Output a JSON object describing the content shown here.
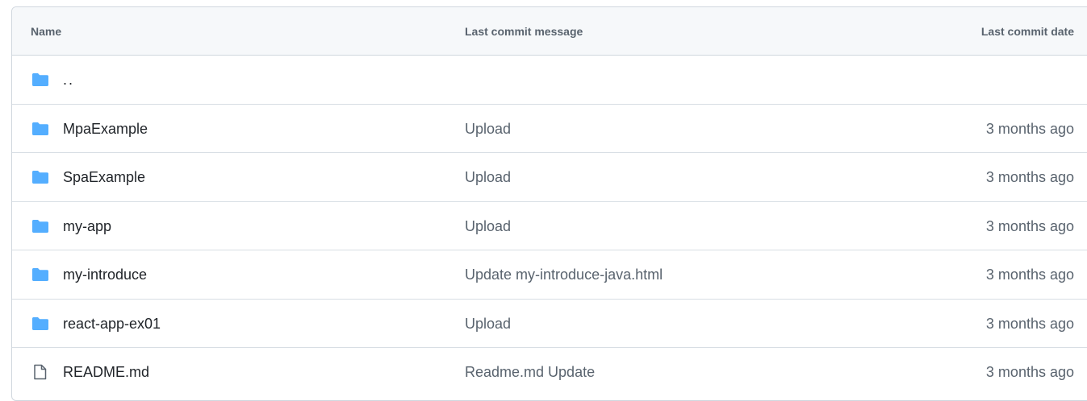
{
  "header": {
    "name": "Name",
    "message": "Last commit message",
    "date": "Last commit date"
  },
  "parent_link": "..",
  "rows": [
    {
      "type": "folder",
      "name": "MpaExample",
      "message": "Upload",
      "date": "3 months ago"
    },
    {
      "type": "folder",
      "name": "SpaExample",
      "message": "Upload",
      "date": "3 months ago"
    },
    {
      "type": "folder",
      "name": "my-app",
      "message": "Upload",
      "date": "3 months ago"
    },
    {
      "type": "folder",
      "name": "my-introduce",
      "message": "Update my-introduce-java.html",
      "date": "3 months ago"
    },
    {
      "type": "folder",
      "name": "react-app-ex01",
      "message": "Upload",
      "date": "3 months ago"
    },
    {
      "type": "file",
      "name": "README.md",
      "message": "Readme.md Update",
      "date": "3 months ago"
    }
  ],
  "icons": {
    "folder": "folder-icon",
    "file": "file-icon"
  },
  "colors": {
    "folder": "#54aeff",
    "header_bg": "#f6f8fa",
    "border": "#d0d7de",
    "muted_text": "#59636e"
  }
}
